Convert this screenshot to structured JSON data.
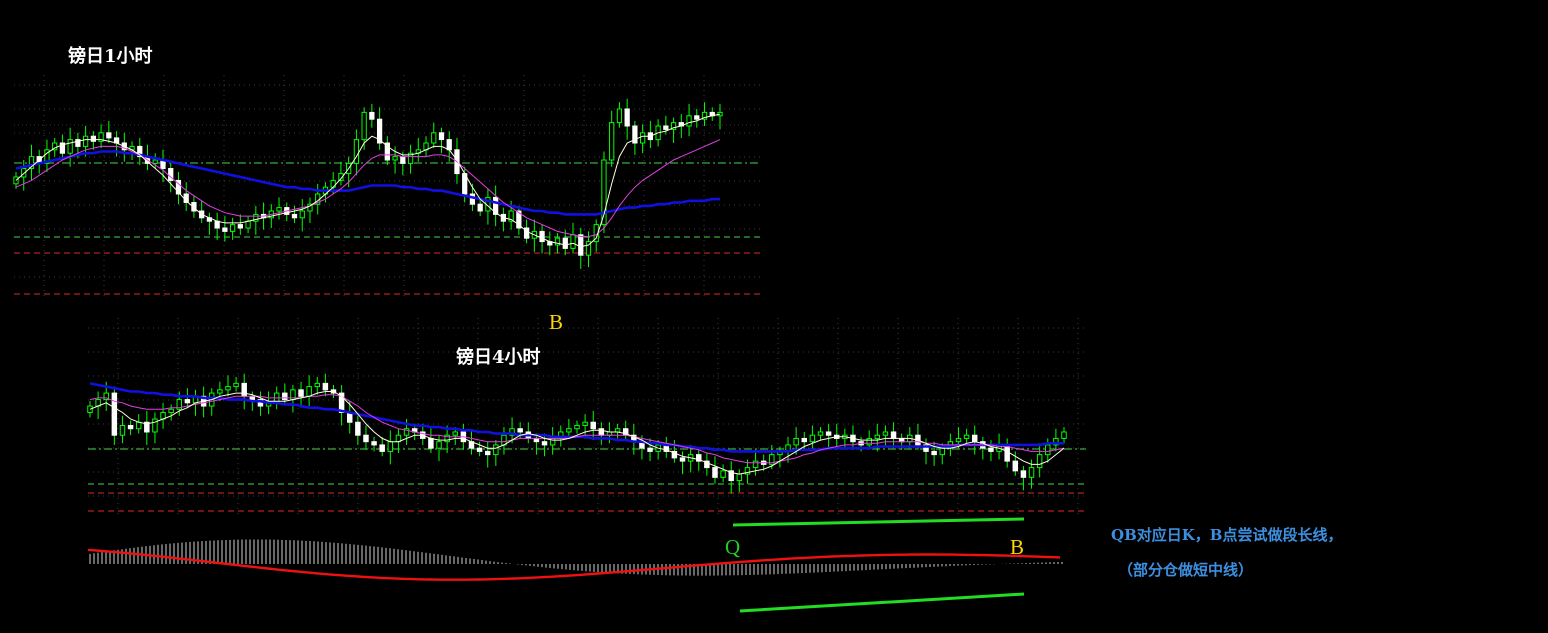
{
  "titles": {
    "chart_1h": "镑日1小时",
    "chart_4h": "镑日4小时"
  },
  "markers": {
    "b_1h": "B",
    "q_4h": "Q",
    "b_4h": "B"
  },
  "notes": {
    "line1": "QB对应日K，B点尝试做段长线，",
    "line2": "（部分仓做短中线）"
  },
  "colors": {
    "background": "#000000",
    "bull_candle": "#00ff00",
    "bear_candle": "#ffffff",
    "ma_fast": "#ffffe0",
    "ma_mid": "#e040e0",
    "ma_slow": "#1010e0",
    "level_green": "#3aa83a",
    "level_red": "#b02020",
    "trend_line": "#22dd22",
    "osc_signal": "#ee1111",
    "marker_yellow": "#ffd700",
    "marker_green": "#22cc22",
    "note_text": "#3d8fe0"
  },
  "chart_data": [
    {
      "type": "candlestick",
      "title": "镑日1小时",
      "close_series": [
        50,
        55,
        62,
        58,
        66,
        70,
        64,
        72,
        68,
        74,
        71,
        76,
        73,
        70,
        66,
        68,
        62,
        58,
        60,
        55,
        48,
        40,
        35,
        30,
        26,
        24,
        20,
        18,
        22,
        20,
        24,
        28,
        26,
        30,
        32,
        28,
        26,
        30,
        34,
        40,
        44,
        48,
        52,
        58,
        72,
        88,
        84,
        70,
        60,
        62,
        58,
        64,
        66,
        70,
        76,
        72,
        66,
        52,
        40,
        34,
        30,
        38,
        28,
        24,
        30,
        20,
        14,
        18,
        12,
        10,
        14,
        8,
        16,
        4,
        12,
        22,
        60,
        82,
        90,
        80,
        70,
        76,
        72,
        80,
        78,
        82,
        80,
        86,
        84,
        88,
        86,
        88
      ],
      "ma_fast": [
        48,
        52,
        56,
        60,
        64,
        67,
        69,
        70,
        71,
        72,
        72,
        72,
        71,
        70,
        68,
        66,
        63,
        59,
        55,
        51,
        46,
        41,
        36,
        32,
        28,
        26,
        24,
        23,
        23,
        23,
        24,
        25,
        26,
        27,
        28,
        29,
        30,
        31,
        33,
        36,
        40,
        44,
        49,
        55,
        62,
        70,
        74,
        72,
        68,
        65,
        63,
        63,
        64,
        66,
        68,
        68,
        66,
        60,
        52,
        44,
        37,
        33,
        29,
        26,
        25,
        22,
        18,
        16,
        14,
        12,
        11,
        10,
        11,
        9,
        10,
        14,
        28,
        46,
        62,
        70,
        72,
        74,
        74,
        76,
        77,
        79,
        80,
        82,
        83,
        85,
        86,
        87
      ],
      "ma_mid": [
        44,
        46,
        48,
        51,
        54,
        57,
        60,
        62,
        64,
        66,
        67,
        68,
        68,
        68,
        67,
        65,
        63,
        60,
        57,
        54,
        50,
        46,
        42,
        39,
        36,
        33,
        31,
        29,
        28,
        27,
        27,
        27,
        27,
        28,
        29,
        30,
        31,
        32,
        33,
        35,
        37,
        40,
        43,
        47,
        52,
        57,
        61,
        63,
        63,
        63,
        62,
        62,
        62,
        62,
        63,
        63,
        62,
        59,
        55,
        51,
        47,
        43,
        39,
        35,
        32,
        29,
        26,
        24,
        22,
        20,
        18,
        17,
        16,
        15,
        15,
        16,
        20,
        26,
        33,
        39,
        44,
        48,
        51,
        54,
        57,
        60,
        62,
        64,
        66,
        68,
        70,
        72
      ],
      "ma_slow": [
        55,
        56,
        57,
        58,
        59,
        60,
        61,
        62,
        63,
        64,
        64,
        65,
        65,
        65,
        64,
        64,
        63,
        62,
        61,
        60,
        59,
        58,
        57,
        56,
        55,
        54,
        53,
        52,
        51,
        50,
        49,
        48,
        47,
        46,
        45,
        44,
        44,
        43,
        43,
        42,
        42,
        42,
        42,
        42,
        43,
        44,
        45,
        45,
        45,
        45,
        44,
        44,
        43,
        43,
        42,
        42,
        41,
        40,
        39,
        38,
        37,
        36,
        35,
        34,
        33,
        32,
        31,
        30,
        30,
        29,
        29,
        28,
        28,
        28,
        28,
        28,
        29,
        30,
        31,
        32,
        32,
        33,
        33,
        34,
        34,
        35,
        35,
        36,
        36,
        36,
        37,
        37
      ]
    },
    {
      "type": "candlestick",
      "title": "镑日4小时",
      "close_series": [
        58,
        62,
        66,
        40,
        46,
        44,
        48,
        42,
        50,
        54,
        56,
        62,
        60,
        64,
        58,
        66,
        68,
        70,
        72,
        64,
        62,
        58,
        60,
        66,
        62,
        68,
        64,
        70,
        72,
        68,
        66,
        54,
        48,
        40,
        36,
        34,
        30,
        36,
        40,
        44,
        42,
        38,
        32,
        36,
        40,
        42,
        36,
        32,
        30,
        28,
        34,
        40,
        44,
        42,
        38,
        36,
        34,
        38,
        42,
        44,
        46,
        48,
        44,
        40,
        42,
        44,
        40,
        36,
        32,
        30,
        34,
        30,
        26,
        24,
        28,
        24,
        20,
        14,
        18,
        12,
        16,
        20,
        24,
        22,
        28,
        30,
        34,
        38,
        36,
        40,
        42,
        40,
        38,
        40,
        36,
        34,
        38,
        40,
        42,
        38,
        36,
        40,
        34,
        30,
        28,
        32,
        36,
        38,
        40,
        36,
        32,
        30,
        34,
        24,
        18,
        14,
        20,
        28,
        34,
        38,
        42
      ],
      "ma_fast": [
        56,
        58,
        60,
        57,
        54,
        50,
        48,
        47,
        48,
        50,
        52,
        55,
        57,
        60,
        61,
        62,
        64,
        65,
        66,
        66,
        65,
        63,
        61,
        61,
        61,
        62,
        63,
        64,
        66,
        67,
        67,
        64,
        59,
        53,
        47,
        42,
        38,
        36,
        36,
        38,
        40,
        40,
        38,
        37,
        37,
        38,
        38,
        36,
        34,
        32,
        32,
        34,
        37,
        40,
        41,
        40,
        38,
        37,
        37,
        38,
        40,
        42,
        43,
        43,
        42,
        42,
        41,
        39,
        37,
        34,
        32,
        31,
        29,
        27,
        26,
        25,
        23,
        21,
        19,
        17,
        16,
        17,
        18,
        19,
        21,
        24,
        27,
        30,
        33,
        35,
        37,
        38,
        39,
        39,
        38,
        37,
        37,
        37,
        38,
        38,
        38,
        38,
        37,
        35,
        33,
        32,
        32,
        33,
        35,
        36,
        35,
        33,
        32,
        30,
        27,
        24,
        22,
        22,
        24,
        28,
        32
      ],
      "ma_mid": [
        62,
        63,
        63,
        61,
        60,
        58,
        57,
        56,
        56,
        56,
        57,
        57,
        58,
        59,
        60,
        61,
        62,
        63,
        64,
        64,
        64,
        64,
        63,
        63,
        63,
        63,
        63,
        64,
        64,
        65,
        65,
        64,
        61,
        58,
        54,
        51,
        48,
        46,
        44,
        43,
        42,
        41,
        40,
        40,
        39,
        39,
        39,
        38,
        37,
        36,
        36,
        36,
        37,
        38,
        38,
        38,
        38,
        38,
        38,
        38,
        39,
        40,
        40,
        40,
        40,
        40,
        40,
        39,
        38,
        37,
        36,
        35,
        34,
        33,
        32,
        31,
        29,
        28,
        26,
        25,
        24,
        23,
        23,
        23,
        23,
        24,
        25,
        26,
        28,
        29,
        31,
        32,
        33,
        34,
        34,
        35,
        35,
        35,
        36,
        36,
        36,
        36,
        36,
        35,
        35,
        34,
        34,
        34,
        34,
        34,
        34,
        34,
        33,
        33,
        32,
        31,
        30,
        30,
        30,
        31,
        32
      ],
      "ma_slow": [
        72,
        71,
        70,
        69,
        68,
        67,
        67,
        66,
        66,
        65,
        65,
        64,
        64,
        64,
        63,
        63,
        63,
        62,
        62,
        62,
        61,
        61,
        60,
        60,
        59,
        59,
        58,
        57,
        57,
        56,
        56,
        55,
        54,
        53,
        52,
        51,
        50,
        49,
        48,
        47,
        46,
        46,
        45,
        45,
        44,
        44,
        43,
        43,
        42,
        42,
        41,
        41,
        41,
        40,
        40,
        40,
        40,
        39,
        39,
        39,
        39,
        39,
        38,
        38,
        38,
        37,
        37,
        36,
        36,
        35,
        35,
        34,
        34,
        33,
        33,
        32,
        32,
        31,
        31,
        30,
        30,
        30,
        30,
        30,
        30,
        30,
        30,
        31,
        31,
        31,
        31,
        32,
        32,
        32,
        32,
        32,
        32,
        33,
        33,
        33,
        33,
        33,
        33,
        33,
        33,
        33,
        33,
        34,
        34,
        34,
        34,
        34,
        34,
        34,
        34,
        34,
        34,
        34,
        35,
        35,
        35
      ]
    }
  ]
}
